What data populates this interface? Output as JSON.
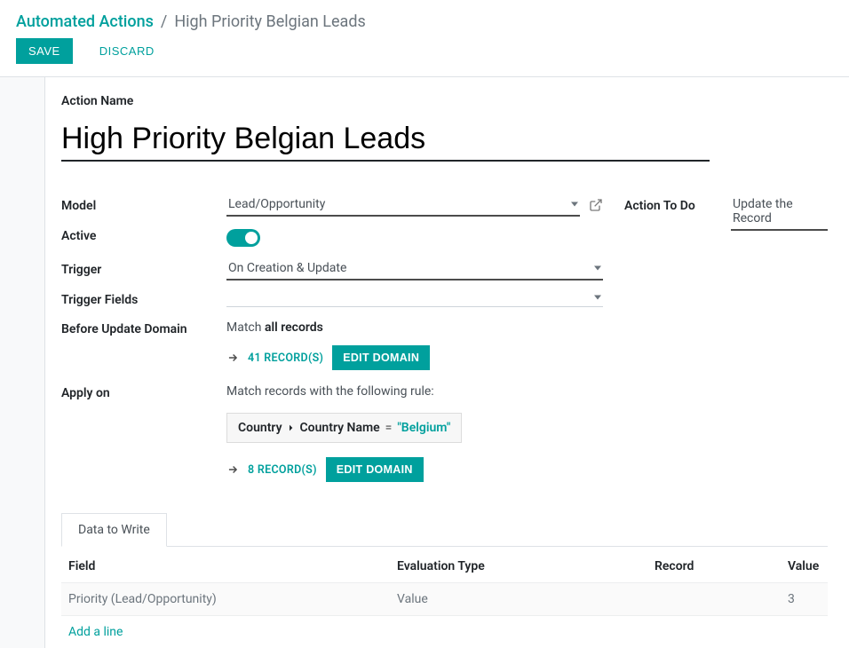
{
  "breadcrumb": {
    "root": "Automated Actions",
    "sep": "/",
    "current": "High Priority Belgian Leads"
  },
  "buttons": {
    "save": "SAVE",
    "discard": "DISCARD"
  },
  "labels": {
    "action_name": "Action Name",
    "model": "Model",
    "active": "Active",
    "trigger": "Trigger",
    "trigger_fields": "Trigger Fields",
    "before_update_domain": "Before Update Domain",
    "apply_on": "Apply on",
    "action_to_do": "Action To Do"
  },
  "fields": {
    "action_name": "High Priority Belgian Leads",
    "model": "Lead/Opportunity",
    "active": true,
    "trigger": "On Creation & Update",
    "trigger_fields": "",
    "action_to_do": "Update the Record"
  },
  "before_domain": {
    "summary_prefix": "Match ",
    "summary_bold": "all records",
    "records_link": "41 RECORD(S)",
    "edit_button": "EDIT DOMAIN"
  },
  "apply_on": {
    "summary": "Match records with the following rule:",
    "rule": {
      "path1": "Country",
      "path2": "Country Name",
      "op": "=",
      "value": "\"Belgium\""
    },
    "records_link": "8 RECORD(S)",
    "edit_button": "EDIT DOMAIN"
  },
  "tabs": {
    "data_to_write": "Data to Write"
  },
  "table": {
    "headers": {
      "field": "Field",
      "eval_type": "Evaluation Type",
      "record": "Record",
      "value": "Value"
    },
    "rows": [
      {
        "field": "Priority (Lead/Opportunity)",
        "eval_type": "Value",
        "record": "",
        "value": "3"
      }
    ],
    "add_line": "Add a line"
  }
}
